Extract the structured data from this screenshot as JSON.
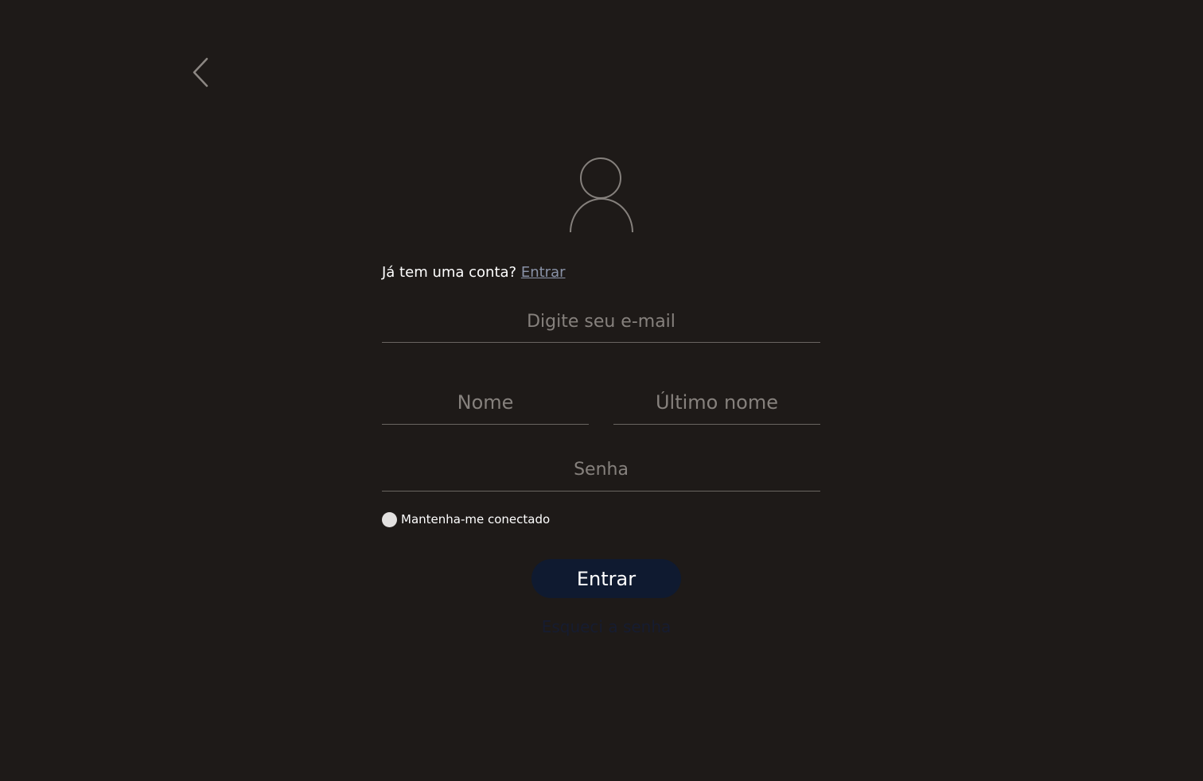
{
  "navigation": {
    "back_icon": "chevron-left-icon"
  },
  "avatar": {
    "icon": "user-icon"
  },
  "signin_prompt": {
    "text": "Já tem uma conta?",
    "link_label": "Entrar"
  },
  "form": {
    "email_placeholder": "Digite seu e-mail",
    "first_name_placeholder": "Nome",
    "last_name_placeholder": "Último nome",
    "password_placeholder": "Senha",
    "remember_label": "Mantenha-me conectado",
    "submit_label": "Entrar",
    "forgot_label": "Esqueci a senha"
  },
  "colors": {
    "background": "#1e1a18",
    "button": "#0f1a30",
    "link": "#8a93a8",
    "forgot_link": "#161c30",
    "field_line": "#6a6561"
  }
}
